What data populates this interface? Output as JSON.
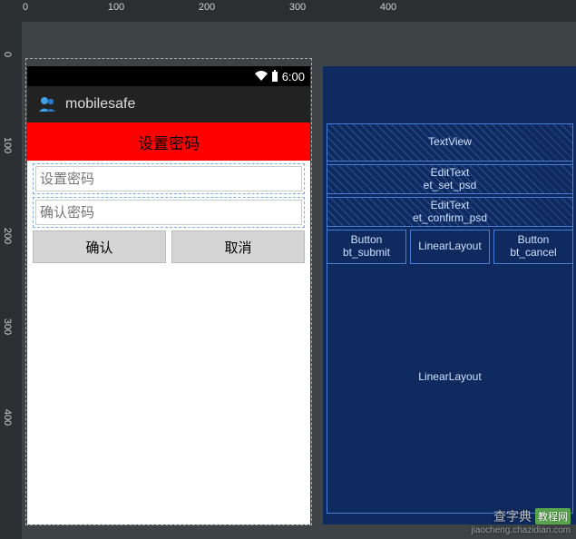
{
  "ruler": {
    "h_ticks": [
      "0",
      "100",
      "200",
      "300",
      "400"
    ],
    "v_ticks": [
      "0",
      "100",
      "200",
      "300",
      "400"
    ]
  },
  "status": {
    "time": "6:00"
  },
  "app": {
    "name": "mobilesafe",
    "title": "设置密码"
  },
  "fields": {
    "set_password_placeholder": "设置密码",
    "confirm_password_placeholder": "确认密码"
  },
  "buttons": {
    "submit": "确认",
    "cancel": "取消"
  },
  "blueprint": {
    "textview": "TextView",
    "edittext1_type": "EditText",
    "edittext1_id": "et_set_psd",
    "edittext2_type": "EditText",
    "edittext2_id": "et_confirm_psd",
    "btn_submit_type": "Button",
    "btn_submit_id": "bt_submit",
    "btn_row_container": "LinearLayout",
    "btn_cancel_type": "Button",
    "btn_cancel_id": "bt_cancel",
    "root": "LinearLayout"
  },
  "watermark": {
    "text": "查字典",
    "badge": "教程网",
    "url": "jiaocheng.chazidian.com"
  }
}
